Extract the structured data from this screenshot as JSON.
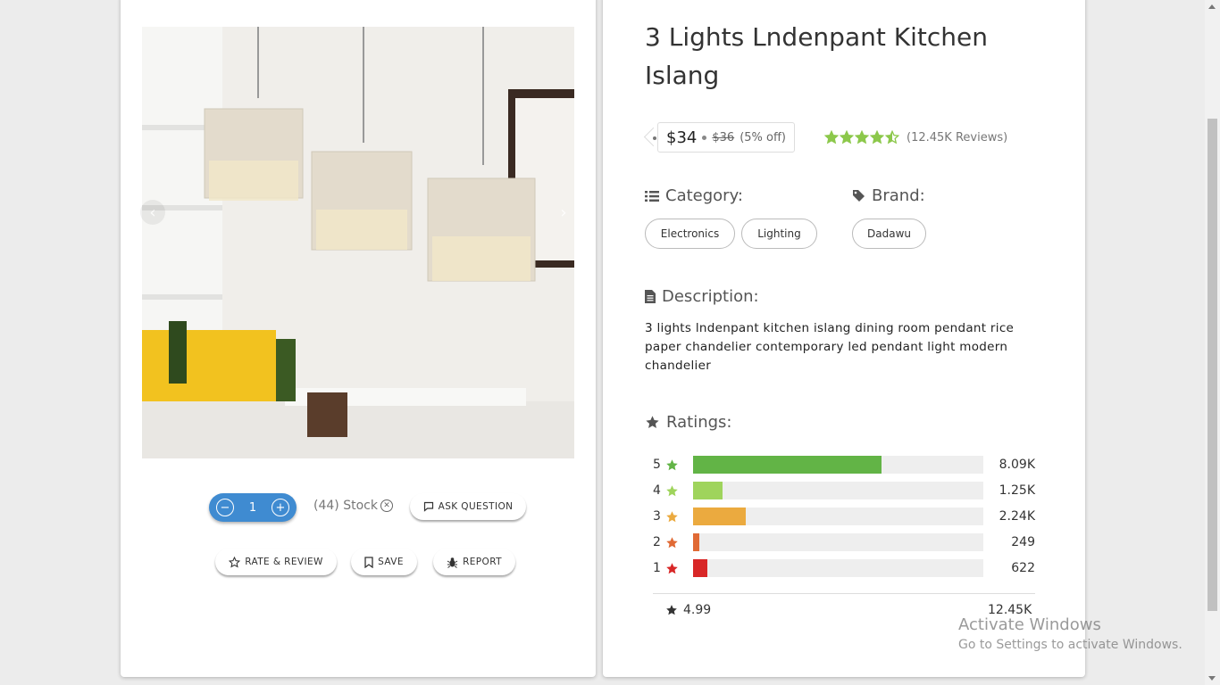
{
  "product": {
    "title": "3 Lights Lndenpant Kitchen Islang",
    "price": "$34",
    "old_price": "$36",
    "discount": "(5% off)",
    "reviews": "(12.45K Reviews)",
    "star_rating": 4.5,
    "category_label": "Category:",
    "categories": [
      "Electronics",
      "Lighting"
    ],
    "brand_label": "Brand:",
    "brand": "Dadawu",
    "description_label": "Description:",
    "description": "3 lights lndenpant kitchen islang dining room pendant rice paper chandelier contemporary led pendant light modern chandelier"
  },
  "actions": {
    "quantity": "1",
    "stock": "(44) Stock",
    "ask_question": "ASK QUESTION",
    "rate_review": "RATE & REVIEW",
    "save": "SAVE",
    "report": "REPORT"
  },
  "ratings": {
    "label": "Ratings:",
    "rows": [
      {
        "stars": "5",
        "count": "8.09K",
        "fraction": 0.65,
        "color": "#62b446"
      },
      {
        "stars": "4",
        "count": "1.25K",
        "fraction": 0.1,
        "color": "#9fd45c"
      },
      {
        "stars": "3",
        "count": "2.24K",
        "fraction": 0.18,
        "color": "#ebaa3f"
      },
      {
        "stars": "2",
        "count": "249",
        "fraction": 0.02,
        "color": "#e06a35"
      },
      {
        "stars": "1",
        "count": "622",
        "fraction": 0.05,
        "color": "#d82727"
      }
    ],
    "average": "4.99",
    "total": "12.45K"
  },
  "watermark": {
    "title": "Activate Windows",
    "subtitle": "Go to Settings to activate Windows."
  },
  "colors": {
    "accent": "#3f8bd1",
    "star_green": "#8cc84b"
  }
}
